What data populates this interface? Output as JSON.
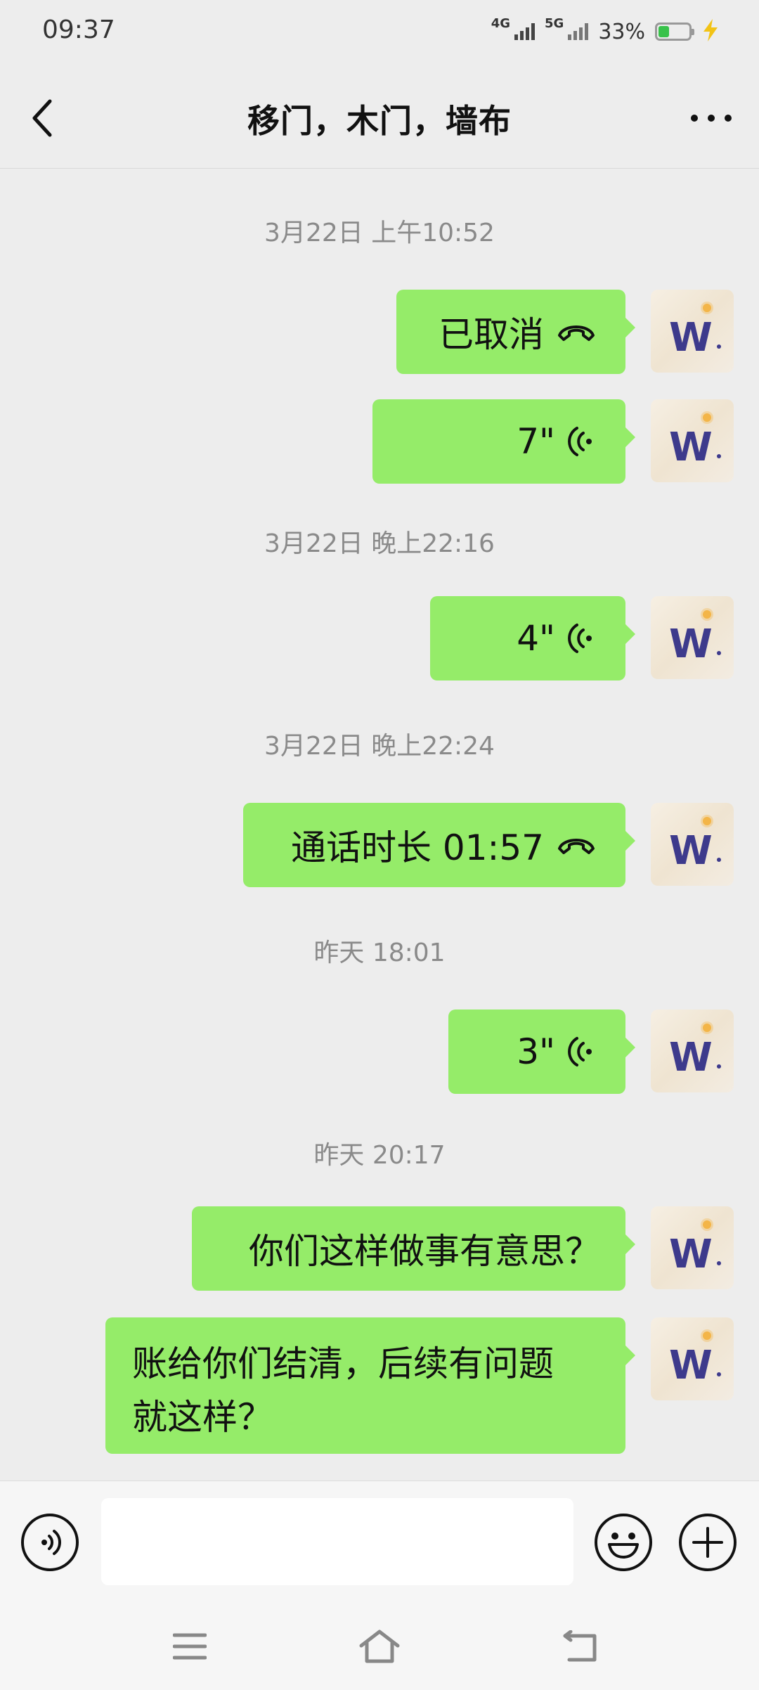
{
  "status_bar": {
    "time": "09:37",
    "network_1": "4G",
    "network_2": "5G",
    "battery_text": "33%",
    "battery_level": 0.33,
    "battery_color": "#38c24a",
    "charging_icon": "bolt-icon"
  },
  "header": {
    "title": "移门，木门，墙布",
    "back_icon": "chevron-left-icon",
    "more_icon": "more-dots-icon"
  },
  "chat": {
    "bubble_color": "#95ec69",
    "timestamps": [
      "3月22日 上午10:52",
      "3月22日 晚上22:16",
      "3月22日 晚上22:24",
      "昨天 18:01",
      "昨天 20:17"
    ],
    "messages": [
      {
        "type": "call",
        "text": "已取消",
        "icon": "phone-hangup-icon"
      },
      {
        "type": "voice",
        "text": "7\"",
        "icon": "voice-wave-icon"
      },
      {
        "type": "voice",
        "text": "4\"",
        "icon": "voice-wave-icon"
      },
      {
        "type": "call",
        "text": "通话时长 01:57",
        "icon": "phone-hangup-icon"
      },
      {
        "type": "voice",
        "text": "3\"",
        "icon": "voice-wave-icon"
      },
      {
        "type": "text",
        "text": "你们这样做事有意思？"
      },
      {
        "type": "text",
        "lines": [
          "账给你们结清，后续有问题",
          "就这样？"
        ]
      }
    ],
    "avatar_letter": "W"
  },
  "input_bar": {
    "placeholder": "",
    "voice_icon": "voice-input-icon",
    "emoji_icon": "emoji-icon",
    "plus_icon": "plus-icon"
  },
  "nav_bar": {
    "menu_icon": "menu-icon",
    "home_icon": "home-icon",
    "back_icon": "back-arrow-icon"
  }
}
